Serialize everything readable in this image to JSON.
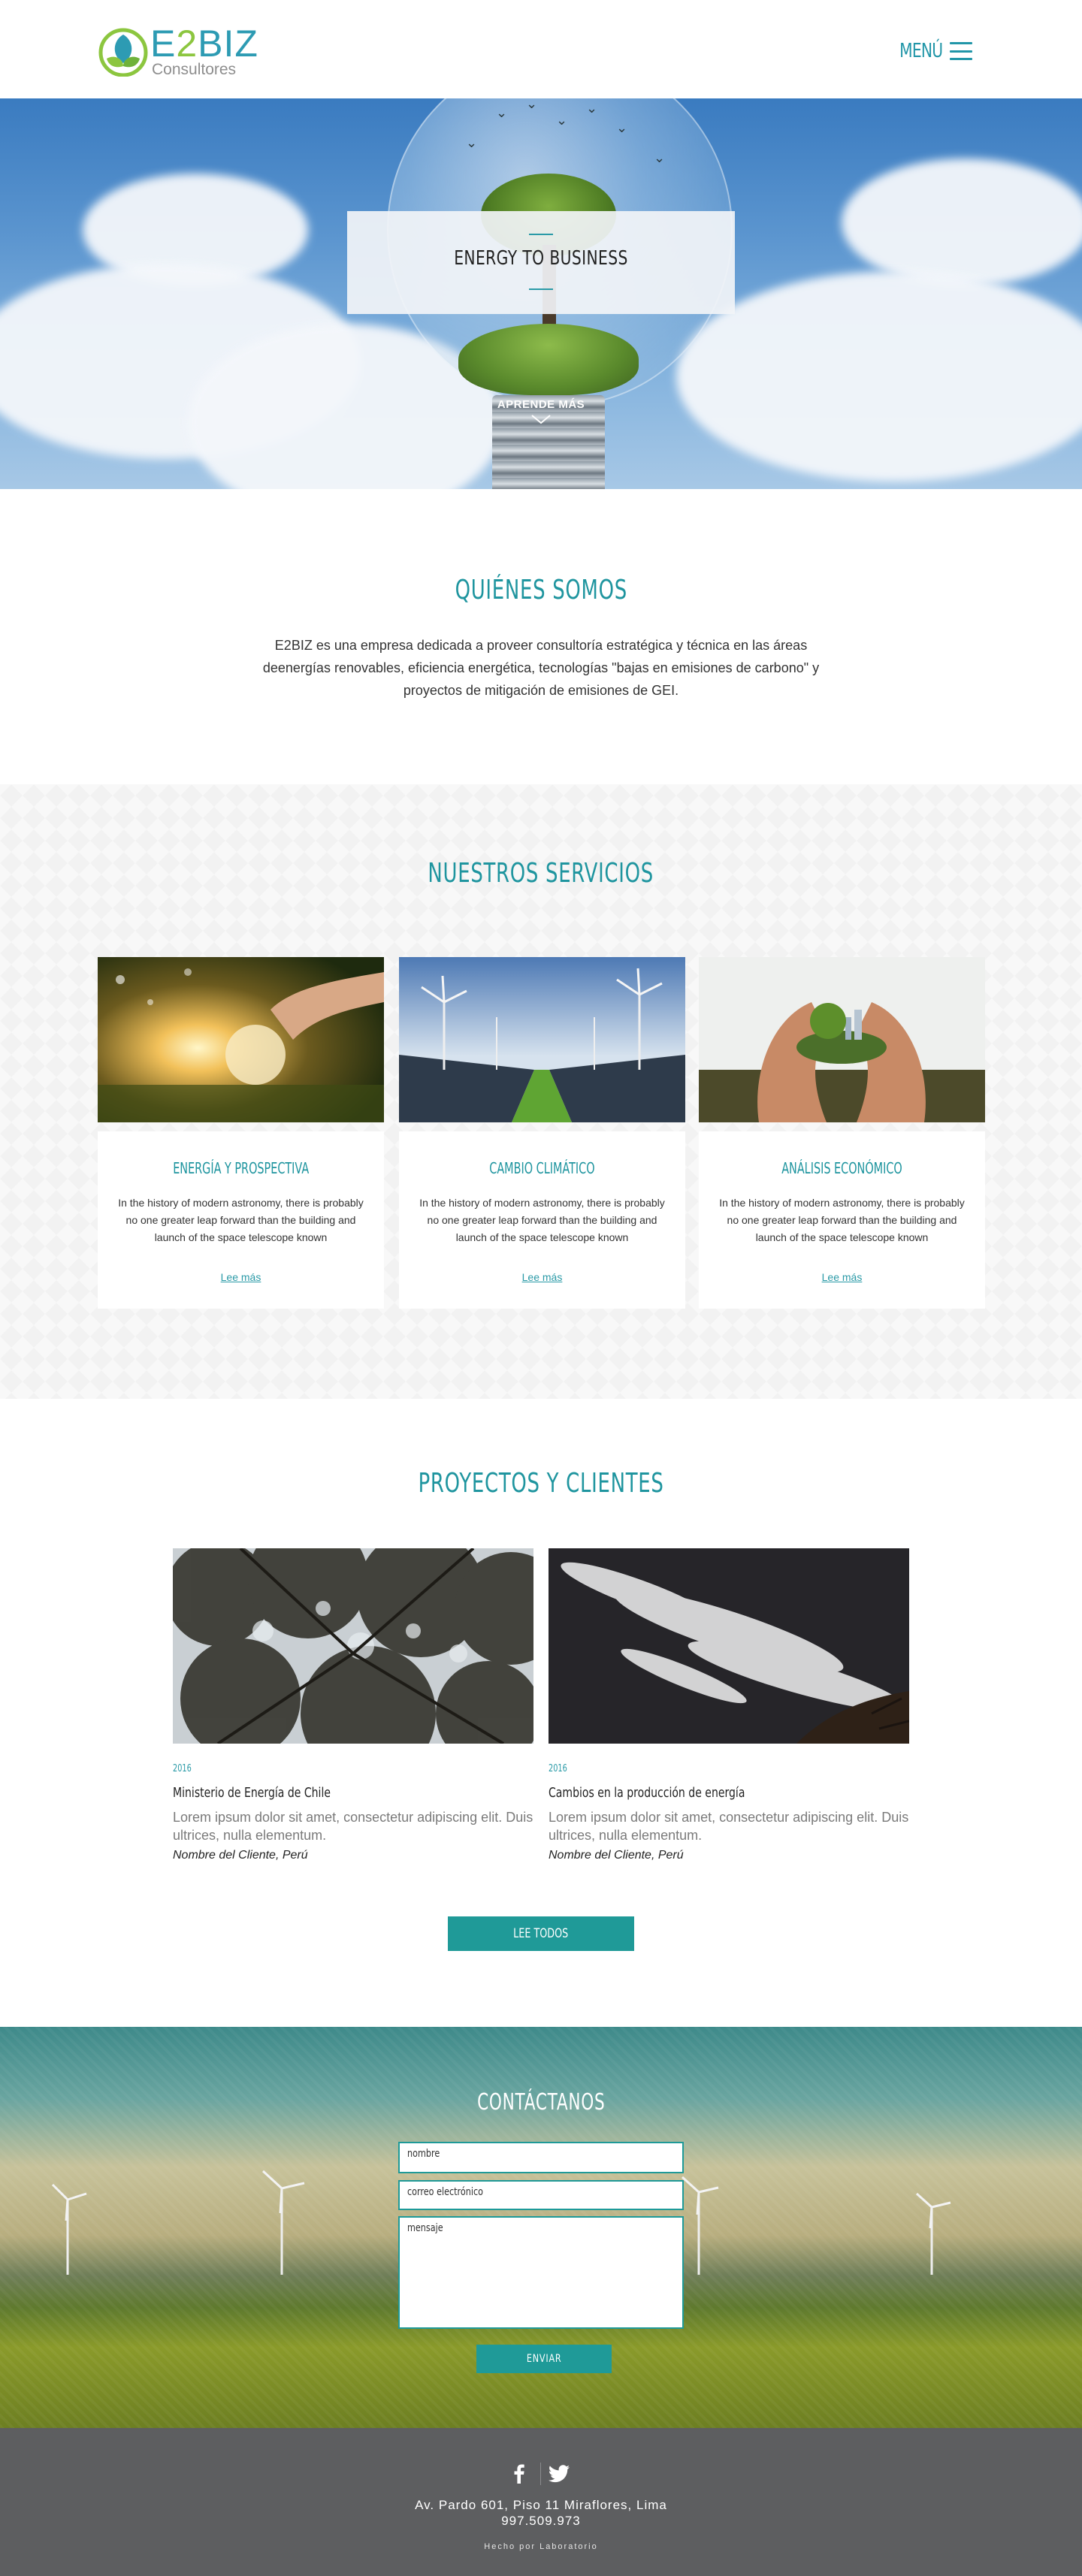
{
  "header": {
    "logo_e": "E",
    "logo_2": "2",
    "logo_biz": "BIZ",
    "logo_sub": "Consultores",
    "menu_label": "MENÚ"
  },
  "hero": {
    "title": "ENERGY TO BUSINESS",
    "learn_more": "APRENDE MÁS"
  },
  "about": {
    "title": "QUIÉNES SOMOS",
    "text": "E2BIZ es una empresa dedicada a proveer consultoría estratégica y técnica en las áreas deenergías renovables, eficiencia energética, tecnologías \"bajas en emisiones de carbono\" y proyectos de mitigación de emisiones de GEI."
  },
  "services": {
    "title": "NUESTROS SERVICIOS",
    "items": [
      {
        "title": "ENERGÍA Y PROSPECTIVA",
        "text": "In the history of modern astronomy, there is probably no one greater leap forward than the building and launch of the space telescope known",
        "link": "Lee más"
      },
      {
        "title": "CAMBIO CLIMÁTICO",
        "text": "In the history of modern astronomy, there is probably no one greater leap forward than the building and launch of the space telescope known",
        "link": "Lee más"
      },
      {
        "title": "ANÁLISIS ECONÓMICO",
        "text": "In the history of modern astronomy, there is probably no one greater leap forward than the building and launch of the space telescope known",
        "link": "Lee más"
      }
    ]
  },
  "projects": {
    "title": "PROYECTOS Y CLIENTES",
    "items": [
      {
        "year": "2016",
        "title": "Ministerio de Energía de Chile",
        "desc": "Lorem ipsum dolor sit amet, consectetur adipiscing elit. Duis ultrices, nulla elementum.",
        "client": "Nombre del Cliente, Perú"
      },
      {
        "year": "2016",
        "title": "Cambios en la producción de energía",
        "desc": "Lorem ipsum dolor sit amet, consectetur adipiscing elit. Duis ultrices, nulla elementum.",
        "client": "Nombre del Cliente, Perú"
      }
    ],
    "button": "LEE TODOS"
  },
  "contact": {
    "title": "CONTÁCTANOS",
    "name_placeholder": "nombre",
    "email_placeholder": "correo electrónico",
    "message_placeholder": "mensaje",
    "send": "ENVIAR"
  },
  "footer": {
    "address": "Av. Pardo 601, Piso 11 Miraflores, Lima",
    "phone": "997.509.973",
    "credit": "Hecho por Laboratorio",
    "social": [
      "facebook-icon",
      "twitter-icon"
    ]
  },
  "colors": {
    "accent": "#1f959f",
    "button": "#1f9a98",
    "footer_bg": "#5d5e60",
    "logo_blue": "#2d9bb3",
    "logo_green": "#8cc63f"
  }
}
